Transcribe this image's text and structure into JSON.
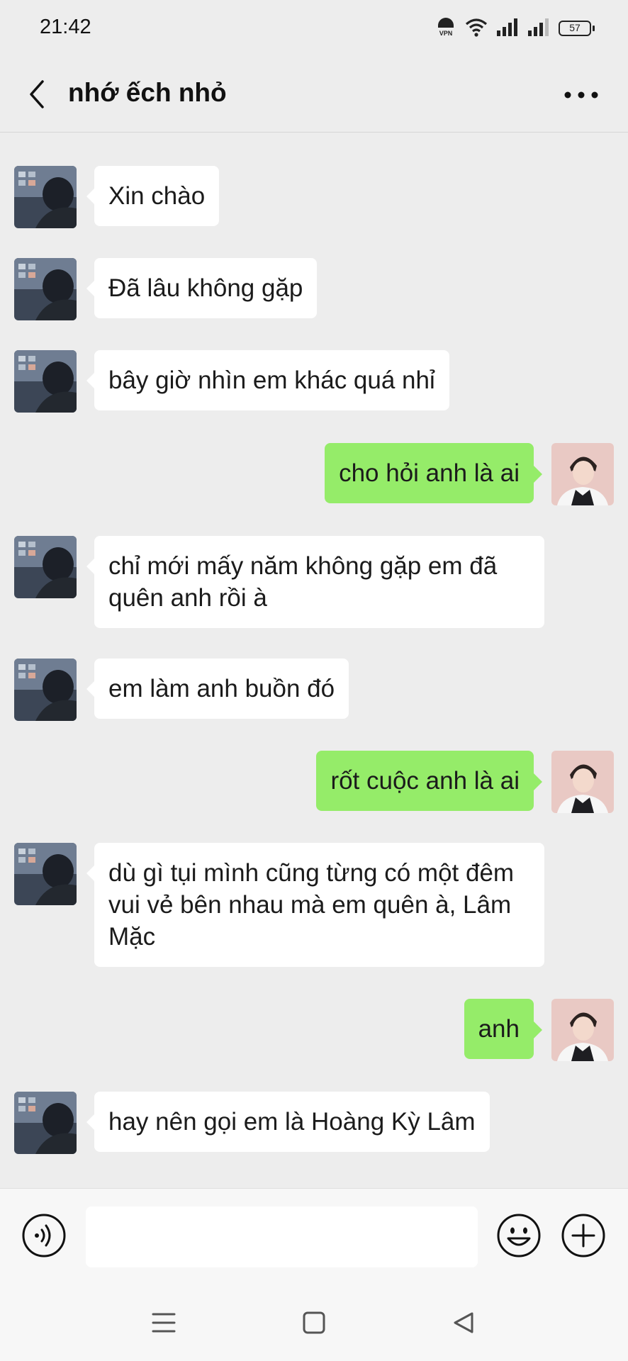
{
  "status_bar": {
    "time": "21:42",
    "vpn_label": "VPN",
    "battery": "57"
  },
  "header": {
    "title": "nhớ ếch nhỏ"
  },
  "messages": [
    {
      "side": "in",
      "text": "Xin chào"
    },
    {
      "side": "in",
      "text": "Đã lâu không gặp"
    },
    {
      "side": "in",
      "text": "bây giờ nhìn em khác quá nhỉ"
    },
    {
      "side": "out",
      "text": "cho hỏi anh là ai"
    },
    {
      "side": "in",
      "text": "chỉ mới mấy năm không gặp em đã quên anh rồi à"
    },
    {
      "side": "in",
      "text": "em làm anh buồn đó"
    },
    {
      "side": "out",
      "text": "rốt cuộc anh là ai"
    },
    {
      "side": "in",
      "text": "dù gì tụi mình cũng từng có một đêm vui vẻ bên nhau mà em quên à, Lâm Mặc"
    },
    {
      "side": "out",
      "text": "anh"
    },
    {
      "side": "in",
      "text": "hay nên gọi em là Hoàng Kỳ Lâm"
    }
  ],
  "input": {
    "value": ""
  },
  "colors": {
    "background": "#ededed",
    "incoming_bubble": "#ffffff",
    "outgoing_bubble": "#95ec69",
    "input_bar": "#f7f7f7"
  },
  "icons": {
    "back": "chevron-left-icon",
    "more": "more-horizontal-icon",
    "voice": "voice-icon",
    "emoji": "emoji-icon",
    "plus": "plus-circle-icon",
    "nav_menu": "menu-icon",
    "nav_home": "home-square-icon",
    "nav_back": "triangle-back-icon"
  }
}
